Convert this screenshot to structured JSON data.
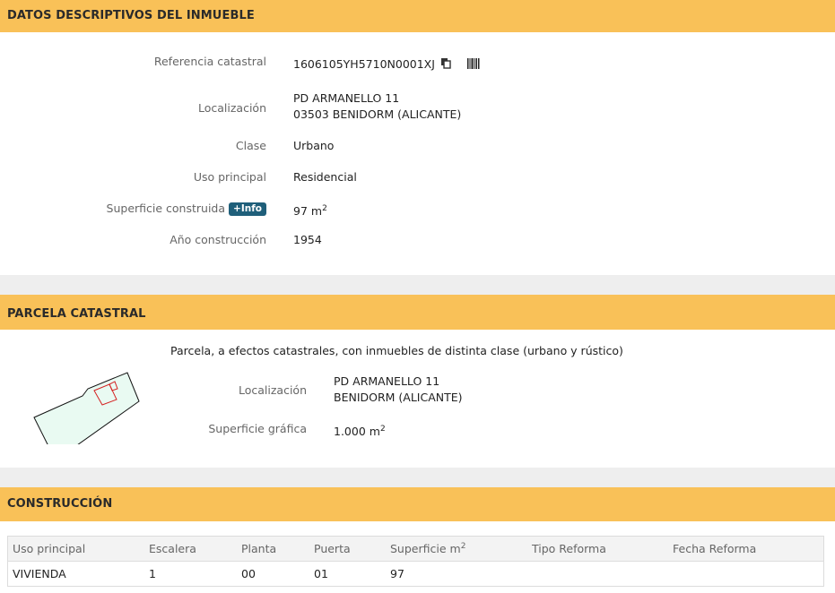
{
  "datos": {
    "title": "DATOS DESCRIPTIVOS DEL INMUEBLE",
    "referencia_label": "Referencia catastral",
    "referencia_value": "1606105YH5710N0001XJ",
    "localizacion_label": "Localización",
    "localizacion_line1": "PD ARMANELLO 11",
    "localizacion_line2": "03503 BENIDORM (ALICANTE)",
    "clase_label": "Clase",
    "clase_value": "Urbano",
    "uso_label": "Uso principal",
    "uso_value": "Residencial",
    "superficie_label": "Superficie construida",
    "info_badge": "+Info",
    "superficie_value": "97 m",
    "superficie_unit_sup": "2",
    "anio_label": "Año construcción",
    "anio_value": "1954",
    "icons": [
      "copy-icon",
      "barcode-icon"
    ]
  },
  "parcela": {
    "title": "PARCELA CATASTRAL",
    "description": "Parcela, a efectos catastrales, con inmuebles de distinta clase (urbano y rústico)",
    "localizacion_label": "Localización",
    "localizacion_line1": "PD ARMANELLO 11",
    "localizacion_line2": "BENIDORM (ALICANTE)",
    "superficie_label": "Superficie gráfica",
    "superficie_value": "1.000 m",
    "superficie_unit_sup": "2",
    "map": {
      "parcel_fill": "#e9faf2",
      "parcel_stroke": "#111111",
      "building_stroke": "#d42020"
    }
  },
  "construccion": {
    "title": "CONSTRUCCIÓN",
    "headers": [
      "Uso principal",
      "Escalera",
      "Planta",
      "Puerta",
      "Superficie m",
      "Tipo Reforma",
      "Fecha Reforma"
    ],
    "superficie_header_sup": "2",
    "rows": [
      [
        "VIVIENDA",
        "1",
        "00",
        "01",
        "97",
        "",
        ""
      ]
    ]
  },
  "colors": {
    "header_bg": "#f9c158",
    "badge_bg": "#1f5f7a",
    "page_bg": "#eeeeee"
  }
}
